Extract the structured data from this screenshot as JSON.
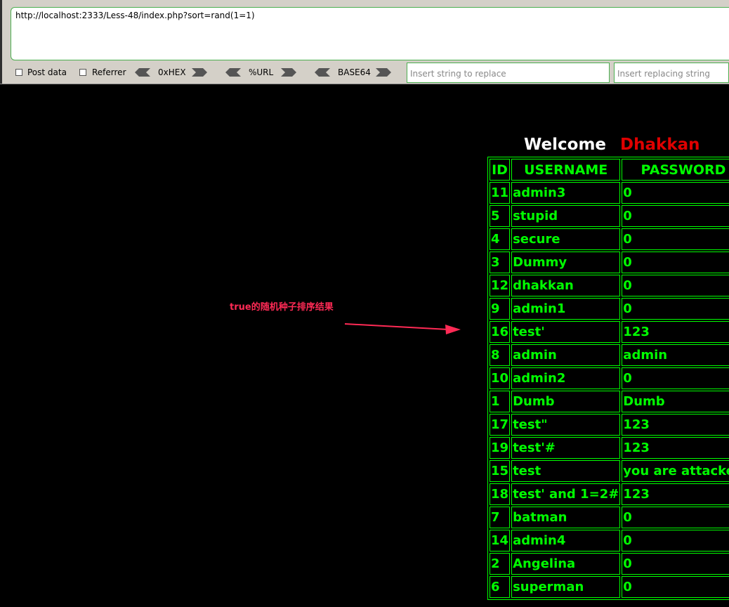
{
  "toolbar": {
    "url": "http://localhost:2333/Less-48/index.php?sort=rand(1=1)",
    "post_data_label": "Post data",
    "referrer_label": "Referrer",
    "hex_label": "0xHEX",
    "url_label": "%URL",
    "base64_label": "BASE64",
    "replace_placeholder": "Insert string to replace",
    "replacing_placeholder": "Insert replacing string"
  },
  "page": {
    "welcome": "Welcome",
    "name": "Dhakkan",
    "name_color": "#e00000",
    "text_color": "#00ff00"
  },
  "table": {
    "headers": [
      "ID",
      "USERNAME",
      "PASSWORD"
    ],
    "rows": [
      [
        "11",
        "admin3",
        "0"
      ],
      [
        "5",
        "stupid",
        "0"
      ],
      [
        "4",
        "secure",
        "0"
      ],
      [
        "3",
        "Dummy",
        "0"
      ],
      [
        "12",
        "dhakkan",
        "0"
      ],
      [
        "9",
        "admin1",
        "0"
      ],
      [
        "16",
        "test'",
        "123"
      ],
      [
        "8",
        "admin",
        "admin"
      ],
      [
        "10",
        "admin2",
        "0"
      ],
      [
        "1",
        "Dumb",
        "Dumb"
      ],
      [
        "17",
        "test\"",
        "123"
      ],
      [
        "19",
        "test'#",
        "123"
      ],
      [
        "15",
        "test",
        "you are attacked"
      ],
      [
        "18",
        "test' and 1=2#",
        "123"
      ],
      [
        "7",
        "batman",
        "0"
      ],
      [
        "14",
        "admin4",
        "0"
      ],
      [
        "2",
        "Angelina",
        "0"
      ],
      [
        "6",
        "superman",
        "0"
      ]
    ]
  },
  "annotation": {
    "text": "true的随机种子排序结果",
    "color": "#ff2a55"
  }
}
